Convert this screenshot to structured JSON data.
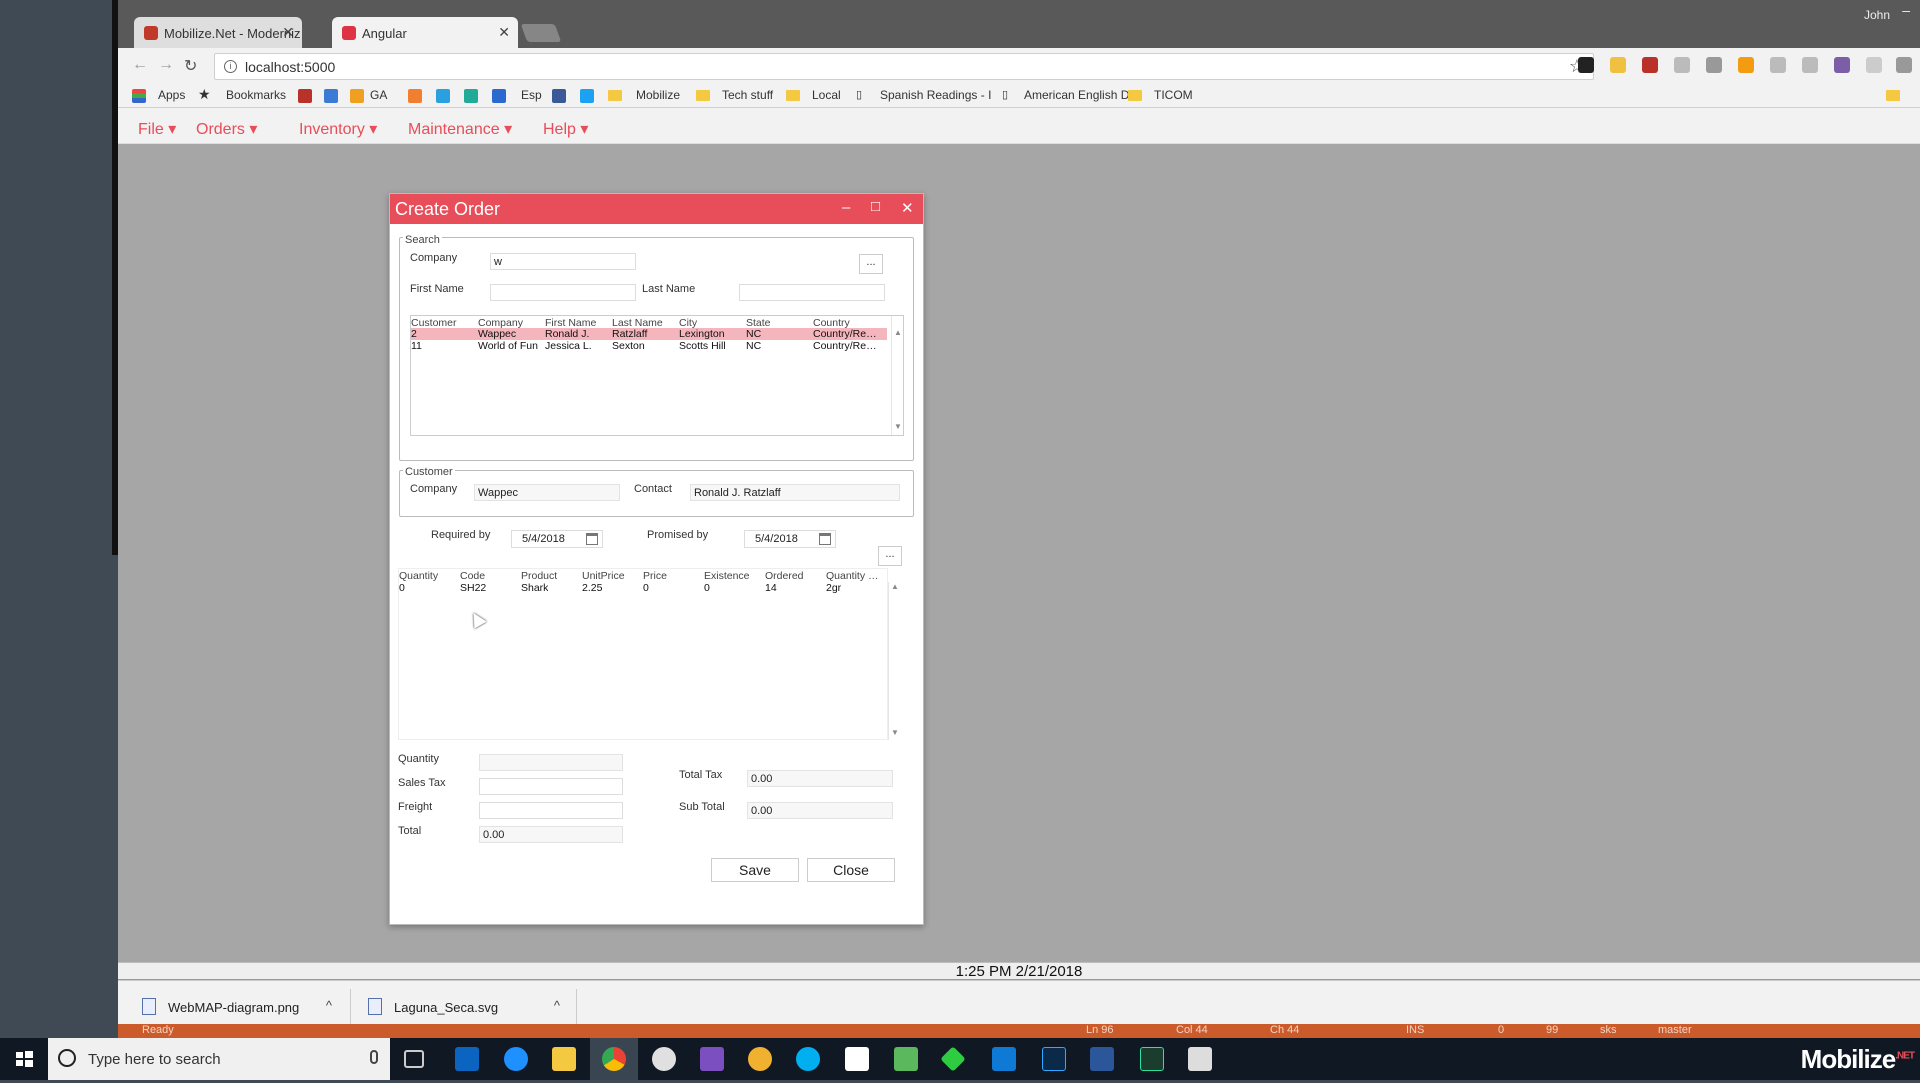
{
  "browser": {
    "tabs": [
      {
        "label": "Mobilize.Net - Moderniz",
        "close": "✕"
      },
      {
        "label": "Angular",
        "close": "✕"
      }
    ],
    "user": "John",
    "url": "localhost:5000",
    "bookmarks": [
      "Apps",
      "Bookmarks",
      "GA",
      "Esp",
      "Mobilize",
      "Tech stuff",
      "Local",
      "Spanish Readings - I",
      "American English Di",
      "TICOM"
    ]
  },
  "app_menu": [
    {
      "label": "File ▾"
    },
    {
      "label": "Orders ▾"
    },
    {
      "label": "Inventory ▾"
    },
    {
      "label": "Maintenance ▾"
    },
    {
      "label": "Help ▾"
    }
  ],
  "dialog": {
    "title": "Create Order",
    "search": {
      "legend": "Search",
      "company_label": "Company",
      "company_value": "w",
      "first_name_label": "First Name",
      "first_name_value": "",
      "last_name_label": "Last Name",
      "last_name_value": "",
      "browse_label": "...",
      "columns": [
        "Customer",
        "Company",
        "First Name",
        "Last Name",
        "City",
        "State",
        "Country"
      ],
      "rows": [
        [
          "2",
          "Wappec",
          "Ronald J.",
          "Ratzlaff",
          "Lexington",
          "NC",
          "Country/Re…"
        ],
        [
          "11",
          "World of Fun",
          "Jessica L.",
          "Sexton",
          "Scotts Hill",
          "NC",
          "Country/Re…"
        ]
      ]
    },
    "customer": {
      "legend": "Customer",
      "company_label": "Company",
      "company_value": "Wappec",
      "contact_label": "Contact",
      "contact_value": "Ronald J. Ratzlaff"
    },
    "dates": {
      "required_label": "Required by",
      "required_value": "5/4/2018",
      "promised_label": "Promised by",
      "promised_value": "5/4/2018",
      "browse_label": "..."
    },
    "items": {
      "columns": [
        "Quantity",
        "Code",
        "Product",
        "UnitPrice",
        "Price",
        "Existence",
        "Ordered",
        "Quantity …"
      ],
      "rows": [
        [
          "0",
          "SH22",
          "Shark",
          "2.25",
          "0",
          "0",
          "14",
          "2gr"
        ]
      ]
    },
    "totals": {
      "quantity_label": "Quantity",
      "quantity_value": "",
      "sales_tax_label": "Sales Tax",
      "sales_tax_value": "",
      "freight_label": "Freight",
      "freight_value": "",
      "total_label": "Total",
      "total_value": "0.00",
      "total_tax_label": "Total Tax",
      "total_tax_value": "0.00",
      "sub_total_label": "Sub Total",
      "sub_total_value": "0.00"
    },
    "buttons": {
      "save": "Save",
      "close": "Close"
    }
  },
  "clock": "1:25 PM 2/21/2018",
  "downloads": [
    {
      "name": "WebMAP-diagram.png",
      "caret": "^"
    },
    {
      "name": "Laguna_Seca.svg",
      "caret": "^"
    }
  ],
  "vs_status": {
    "ready": "Ready",
    "ln": "Ln 96",
    "col": "Col 44",
    "ch": "Ch 44",
    "ins": "INS",
    "up": "0",
    "edits": "99",
    "repo": "sks",
    "branch": "master"
  },
  "taskbar": {
    "search_placeholder": "Type here to search",
    "brand": "Mobilize",
    "brand_suffix": ".NET"
  },
  "colors": {
    "accent": "#e84d5a",
    "selection": "#f4b6bc",
    "app_background": "#a6a6a6",
    "taskbar": "#101923"
  }
}
